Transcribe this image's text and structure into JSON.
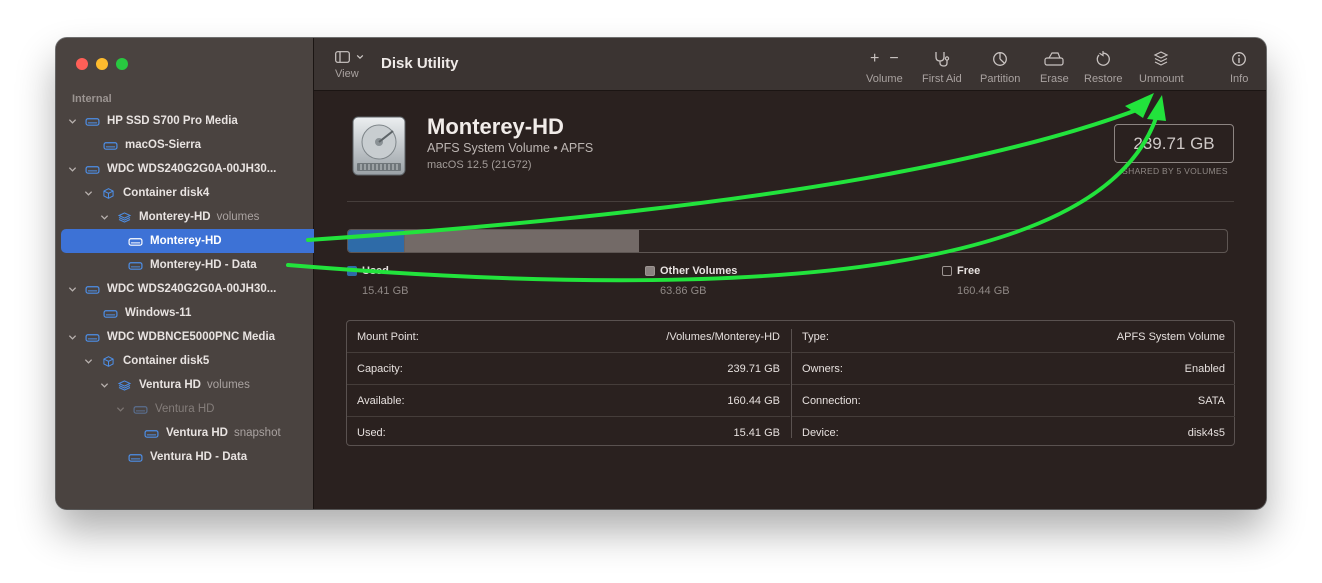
{
  "window": {
    "title": "Disk Utility"
  },
  "sidebar": {
    "section": "Internal",
    "items": [
      {
        "label": "HP SSD S700 Pro Media",
        "sub": ""
      },
      {
        "label": "macOS-Sierra",
        "sub": ""
      },
      {
        "label": "WDC WDS240G2G0A-00JH30...",
        "sub": ""
      },
      {
        "label": "Container disk4",
        "sub": ""
      },
      {
        "label": "Monterey-HD",
        "sub": "volumes"
      },
      {
        "label": "Monterey-HD",
        "sub": ""
      },
      {
        "label": "Monterey-HD - Data",
        "sub": ""
      },
      {
        "label": "WDC WDS240G2G0A-00JH30...",
        "sub": ""
      },
      {
        "label": "Windows-11",
        "sub": ""
      },
      {
        "label": "WDC WDBNCE5000PNC Media",
        "sub": ""
      },
      {
        "label": "Container disk5",
        "sub": ""
      },
      {
        "label": "Ventura HD",
        "sub": "volumes"
      },
      {
        "label": "Ventura HD",
        "sub": ""
      },
      {
        "label": "Ventura HD",
        "sub": "snapshot"
      },
      {
        "label": "Ventura HD - Data",
        "sub": ""
      }
    ]
  },
  "toolbar": {
    "view": "View",
    "volume": "Volume",
    "first_aid": "First Aid",
    "partition": "Partition",
    "erase": "Erase",
    "restore": "Restore",
    "unmount": "Unmount",
    "info": "Info",
    "add_symbol": "+",
    "remove_symbol": "−"
  },
  "volume": {
    "name": "Monterey-HD",
    "type": "APFS System Volume • APFS",
    "os": "macOS 12.5 (21G72)",
    "capacity": "239.71 GB",
    "capacity_note": "SHARED BY 5 VOLUMES"
  },
  "usage": {
    "used_fraction": 0.0643,
    "other_fraction": 0.2664,
    "free_fraction": 0.6693,
    "used_color": "#2e6ba8",
    "other_color": "#736a67",
    "legend": [
      {
        "label": "Used",
        "value": "15.41 GB"
      },
      {
        "label": "Other Volumes",
        "value": "63.86 GB"
      },
      {
        "label": "Free",
        "value": "160.44 GB"
      }
    ]
  },
  "info": {
    "left": [
      {
        "key": "Mount Point:",
        "value": "/Volumes/Monterey-HD"
      },
      {
        "key": "Capacity:",
        "value": "239.71 GB"
      },
      {
        "key": "Available:",
        "value": "160.44 GB"
      },
      {
        "key": "Used:",
        "value": "15.41 GB"
      }
    ],
    "right": [
      {
        "key": "Type:",
        "value": "APFS System Volume"
      },
      {
        "key": "Owners:",
        "value": "Enabled"
      },
      {
        "key": "Connection:",
        "value": "SATA"
      },
      {
        "key": "Device:",
        "value": "disk4s5"
      }
    ]
  },
  "annotation": {
    "arrow_color": "#22e33c"
  }
}
